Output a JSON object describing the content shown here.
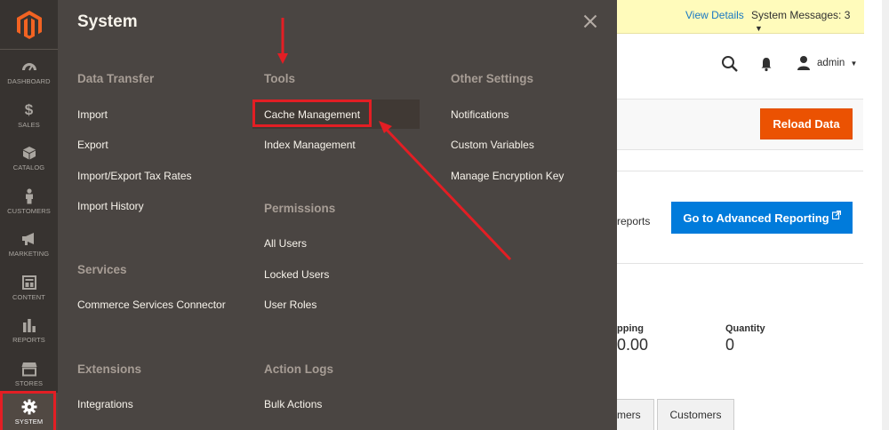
{
  "nav": {
    "items": [
      {
        "label": "DASHBOARD",
        "icon": "dashboard-icon"
      },
      {
        "label": "SALES",
        "icon": "dollar-icon",
        "glyph": "$"
      },
      {
        "label": "CATALOG",
        "icon": "cube-icon"
      },
      {
        "label": "CUSTOMERS",
        "icon": "person-icon"
      },
      {
        "label": "MARKETING",
        "icon": "megaphone-icon"
      },
      {
        "label": "CONTENT",
        "icon": "layout-icon"
      },
      {
        "label": "REPORTS",
        "icon": "bar-chart-icon"
      },
      {
        "label": "STORES",
        "icon": "storefront-icon"
      },
      {
        "label": "SYSTEM",
        "icon": "gear-icon"
      }
    ]
  },
  "header": {
    "view_details": "View Details",
    "system_messages": "System Messages: 3",
    "admin": "admin"
  },
  "page": {
    "reload_button": "Reload Data",
    "reports_text": "reports",
    "advanced_button": "Go to Advanced Reporting",
    "stat1_label": "pping",
    "stat1_value": "0.00",
    "stat2_label": "Quantity",
    "stat2_value": "0",
    "tab1": "mers",
    "tab2": "Customers"
  },
  "flyout": {
    "title": "System",
    "data_transfer": {
      "title": "Data Transfer",
      "items": [
        "Import",
        "Export",
        "Import/Export Tax Rates",
        "Import History"
      ]
    },
    "services": {
      "title": "Services",
      "items": [
        "Commerce Services Connector"
      ]
    },
    "extensions": {
      "title": "Extensions",
      "items": [
        "Integrations"
      ]
    },
    "tools": {
      "title": "Tools",
      "items": [
        "Cache Management",
        "Index Management"
      ]
    },
    "permissions": {
      "title": "Permissions",
      "items": [
        "All Users",
        "Locked Users",
        "User Roles"
      ]
    },
    "action_logs": {
      "title": "Action Logs",
      "items": [
        "Bulk Actions"
      ]
    },
    "other_settings": {
      "title": "Other Settings",
      "items": [
        "Notifications",
        "Custom Variables",
        "Manage Encryption Key"
      ]
    }
  },
  "colors": {
    "accent_orange": "#eb5202",
    "accent_blue": "#007bdb",
    "highlight_red": "#e31e24"
  }
}
